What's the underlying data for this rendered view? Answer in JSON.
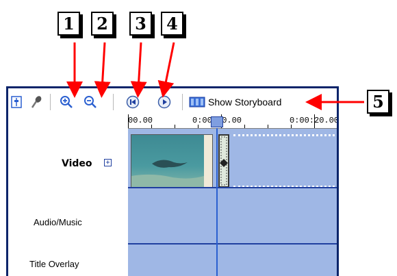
{
  "callouts": [
    "1",
    "2",
    "3",
    "4",
    "5"
  ],
  "toolbar": {
    "items": [
      {
        "name": "set-audio-levels-icon",
        "interactive": true
      },
      {
        "name": "narrate-timeline-icon",
        "interactive": true
      },
      {
        "name": "zoom-in-icon",
        "interactive": true
      },
      {
        "name": "zoom-out-icon",
        "interactive": true
      },
      {
        "name": "rewind-icon",
        "interactive": true
      },
      {
        "name": "play-icon",
        "interactive": true
      }
    ],
    "storyboard_label": "Show Storyboard"
  },
  "ruler": {
    "labels": [
      "00.00",
      "0:00:10.00",
      "0:00:20.00"
    ]
  },
  "tracks": [
    {
      "label": "Video",
      "expand_symbol": "+"
    },
    {
      "label": "Audio/Music"
    },
    {
      "label": "Title Overlay"
    }
  ],
  "colors": {
    "track_fill": "#9fb7e5",
    "playhead": "#2a5fd0",
    "arrow": "#ff0000",
    "window_border": "#0a246a"
  }
}
